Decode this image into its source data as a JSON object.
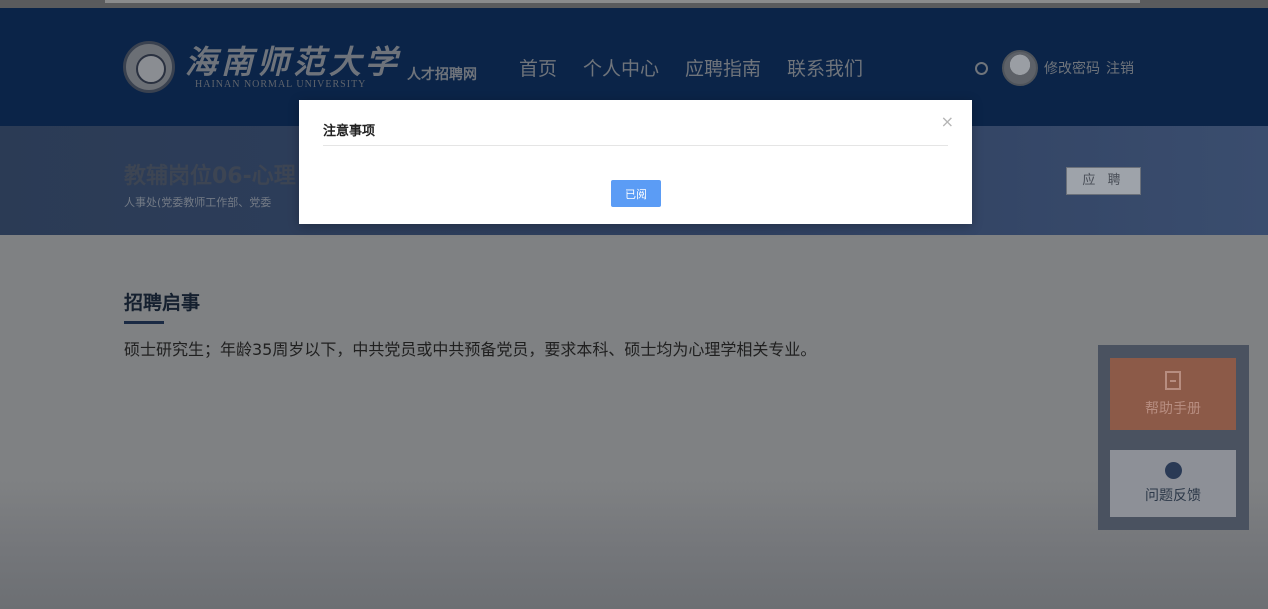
{
  "header": {
    "logo_cn": "海南师范大学",
    "logo_en": "HAINAN NORMAL UNIVERSITY",
    "logo_sub": "人才招聘网",
    "nav": [
      "首页",
      "个人中心",
      "应聘指南",
      "联系我们"
    ],
    "user_links": {
      "change_password": "修改密码",
      "logout": "注销"
    }
  },
  "banner": {
    "title": "教辅岗位06-心理",
    "subtitle": "人事处(党委教师工作部、党委",
    "apply_label": "应 聘"
  },
  "content": {
    "section_title": "招聘启事",
    "body": "硕士研究生；年龄35周岁以下，中共党员或中共预备党员，要求本科、硕士均为心理学相关专业。"
  },
  "side_panel": {
    "help_label": "帮助手册",
    "feedback_label": "问题反馈"
  },
  "modal": {
    "title": "注意事项",
    "close_glyph": "×",
    "confirm_label": "已阅"
  },
  "colors": {
    "header_bg": "#0b2448",
    "modal_button": "#5b9cf5",
    "help_button": "#8c5a48"
  }
}
